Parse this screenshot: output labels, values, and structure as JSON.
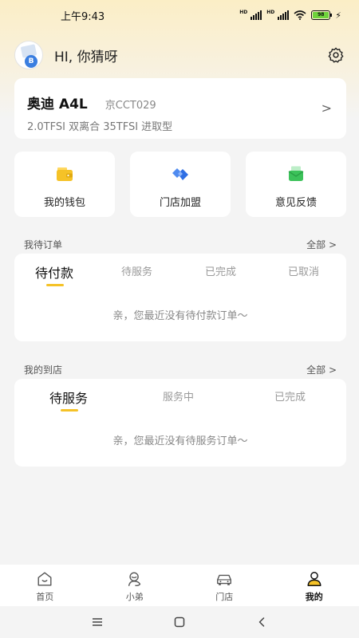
{
  "status_bar": {
    "time": "上午9:43",
    "battery": "98"
  },
  "header": {
    "greeting": "HI, 你猜呀"
  },
  "car": {
    "name": "奥迪 A4L",
    "plate": "京CCT029",
    "spec": "2.0TFSI 双离合 35TFSI 进取型"
  },
  "shortcuts": [
    {
      "label": "我的钱包",
      "icon": "wallet-icon"
    },
    {
      "label": "门店加盟",
      "icon": "store-join-icon"
    },
    {
      "label": "意见反馈",
      "icon": "feedback-icon"
    }
  ],
  "pending_orders": {
    "title": "我待订单",
    "more": "全部 >",
    "tabs": [
      "待付款",
      "待服务",
      "已完成",
      "已取消"
    ],
    "active_tab": 0,
    "empty_message": "亲，您最近没有待付款订单～"
  },
  "my_visits": {
    "title": "我的到店",
    "more": "全部 >",
    "tabs": [
      "待服务",
      "服务中",
      "已完成"
    ],
    "active_tab": 0,
    "empty_message": "亲，您最近没有待服务订单～"
  },
  "tabbar": {
    "items": [
      {
        "label": "首页",
        "icon": "home-icon"
      },
      {
        "label": "小弟",
        "icon": "assistant-icon"
      },
      {
        "label": "门店",
        "icon": "car-store-icon"
      },
      {
        "label": "我的",
        "icon": "profile-icon"
      }
    ],
    "active": 3
  },
  "colors": {
    "accent": "#f5c227",
    "background": "#f4f4f4",
    "header_gradient": "#fbeec6"
  }
}
